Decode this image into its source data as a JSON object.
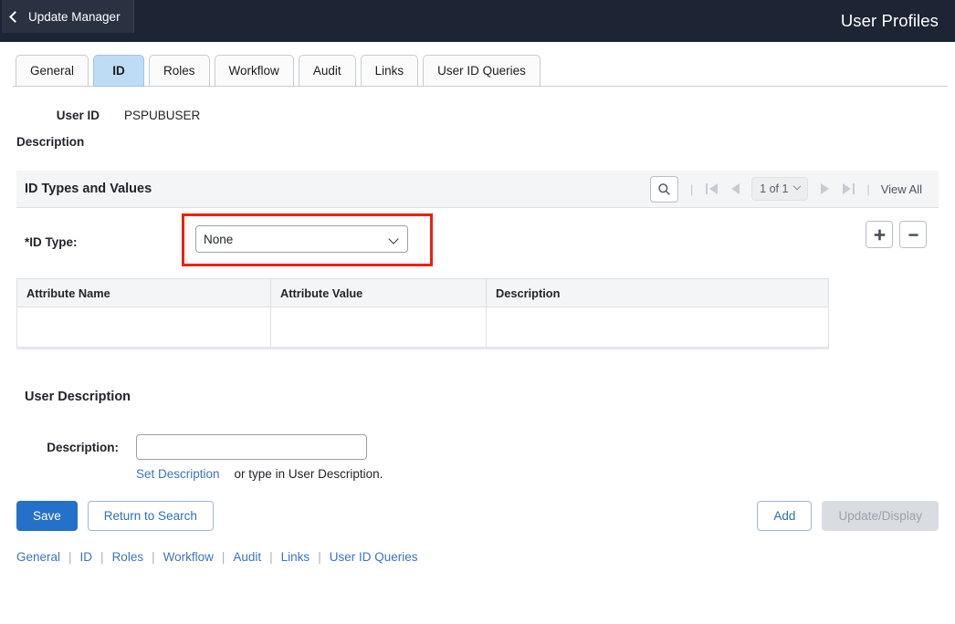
{
  "header": {
    "back_label": "Update Manager",
    "back_icon": "chevron-left-icon",
    "title": "User Profiles",
    "bg_color": "#1d2433"
  },
  "tabs": [
    {
      "label": "General",
      "active": false
    },
    {
      "label": "ID",
      "active": true
    },
    {
      "label": "Roles",
      "active": false
    },
    {
      "label": "Workflow",
      "active": false
    },
    {
      "label": "Audit",
      "active": false
    },
    {
      "label": "Links",
      "active": false
    },
    {
      "label": "User ID Queries",
      "active": false
    }
  ],
  "user": {
    "user_id_label": "User ID",
    "user_id_value": "PSPUBUSER",
    "description_label": "Description",
    "description_value": ""
  },
  "grid": {
    "title": "ID Types and Values",
    "search_icon": "search-icon",
    "first_icon": "first-page-icon",
    "prev_icon": "previous-page-icon",
    "page_indicator": "1 of 1",
    "page_chevron_icon": "chevron-down-icon",
    "next_icon": "next-page-icon",
    "last_icon": "last-page-icon",
    "view_all_label": "View All",
    "separator": "|"
  },
  "id_type": {
    "label": "*ID Type:",
    "selected": "None",
    "options": [
      "None"
    ],
    "highlight_color": "#f01f0d",
    "add_row_label": "+",
    "add_row_icon": "plus-icon",
    "delete_row_label": "–",
    "delete_row_icon": "minus-icon"
  },
  "attributes_table": {
    "columns": [
      "Attribute Name",
      "Attribute Value",
      "Description"
    ],
    "rows": [
      {
        "attribute_name": "",
        "attribute_value": "",
        "description": ""
      }
    ]
  },
  "user_description": {
    "section_title": "User Description",
    "description_label": "Description:",
    "description_value": "",
    "set_description_link": "Set Description",
    "hint": "or type in User Description."
  },
  "actions": {
    "save": "Save",
    "return_to_search": "Return to Search",
    "add": "Add",
    "update_display": "Update/Display"
  },
  "footer_links": {
    "separator": "|",
    "items": [
      "General",
      "ID",
      "Roles",
      "Workflow",
      "Audit",
      "Links",
      "User ID Queries"
    ]
  }
}
